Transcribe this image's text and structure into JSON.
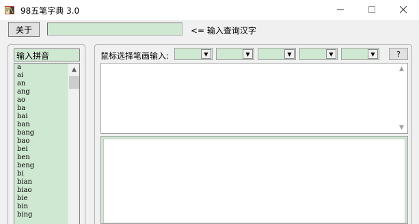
{
  "window": {
    "title": "98五笔字典 3.0",
    "controls": {
      "minimize": "—",
      "maximize": "☐",
      "close": "✕"
    }
  },
  "toolbar": {
    "about_label": "关于",
    "query_value": "",
    "query_hint": "<= 输入查询汉字"
  },
  "pinyin_panel": {
    "header": "输入拼音",
    "items": [
      "a",
      "ai",
      "an",
      "ang",
      "ao",
      "ba",
      "bai",
      "ban",
      "bang",
      "bao",
      "bei",
      "ben",
      "beng",
      "bi",
      "bian",
      "biao",
      "bie",
      "bin",
      "bing"
    ]
  },
  "stroke_panel": {
    "label": "鼠标选择笔画输入:",
    "selects": [
      "",
      "",
      "",
      "",
      ""
    ],
    "help_label": "?"
  },
  "colors": {
    "field_green": "#cfe8d2",
    "window_bg": "#f0f0f0"
  },
  "icons": {
    "app": "dictionary-book-icon",
    "scroll_up": "up-arrow-icon",
    "dropdown": "down-arrow-icon"
  }
}
